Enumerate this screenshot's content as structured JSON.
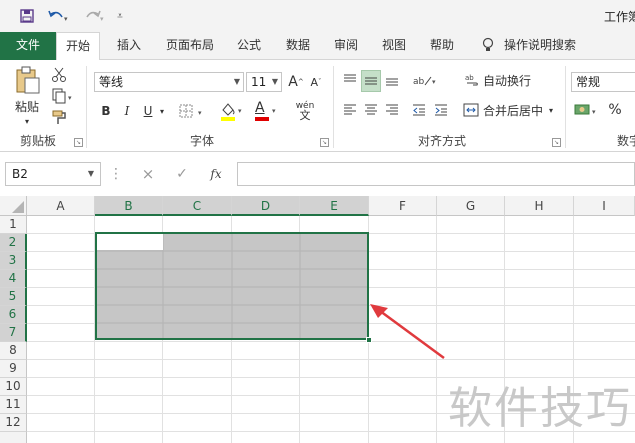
{
  "app": {
    "title": "工作簿"
  },
  "tabs": [
    "文件",
    "开始",
    "插入",
    "页面布局",
    "公式",
    "数据",
    "审阅",
    "视图",
    "帮助"
  ],
  "tell_me": "操作说明搜索",
  "clipboard": {
    "paste": "粘贴",
    "group": "剪贴板"
  },
  "font": {
    "name": "等线",
    "size": "11",
    "group": "字体",
    "grow": "A",
    "shrink": "A",
    "bold": "B",
    "italic": "I",
    "underline": "U",
    "font_color": "A",
    "phonetic": "wén"
  },
  "alignment": {
    "wrap": "自动换行",
    "merge": "合并后居中",
    "group": "对齐方式"
  },
  "number": {
    "format": "常规",
    "group": "数字",
    "percent": "%"
  },
  "formula_bar": {
    "name_box": "B2",
    "fx": "fx",
    "cancel": "×",
    "enter": "✓"
  },
  "columns": [
    "A",
    "B",
    "C",
    "D",
    "E",
    "F",
    "G",
    "H",
    "I"
  ],
  "rows": [
    "1",
    "2",
    "3",
    "4",
    "5",
    "6",
    "7",
    "8",
    "9",
    "10",
    "11",
    "12"
  ],
  "watermark": "软件技巧",
  "colors": {
    "excel_green": "#217346",
    "selection_fill": "#c6c6c6",
    "arrow": "#e03a3e"
  }
}
